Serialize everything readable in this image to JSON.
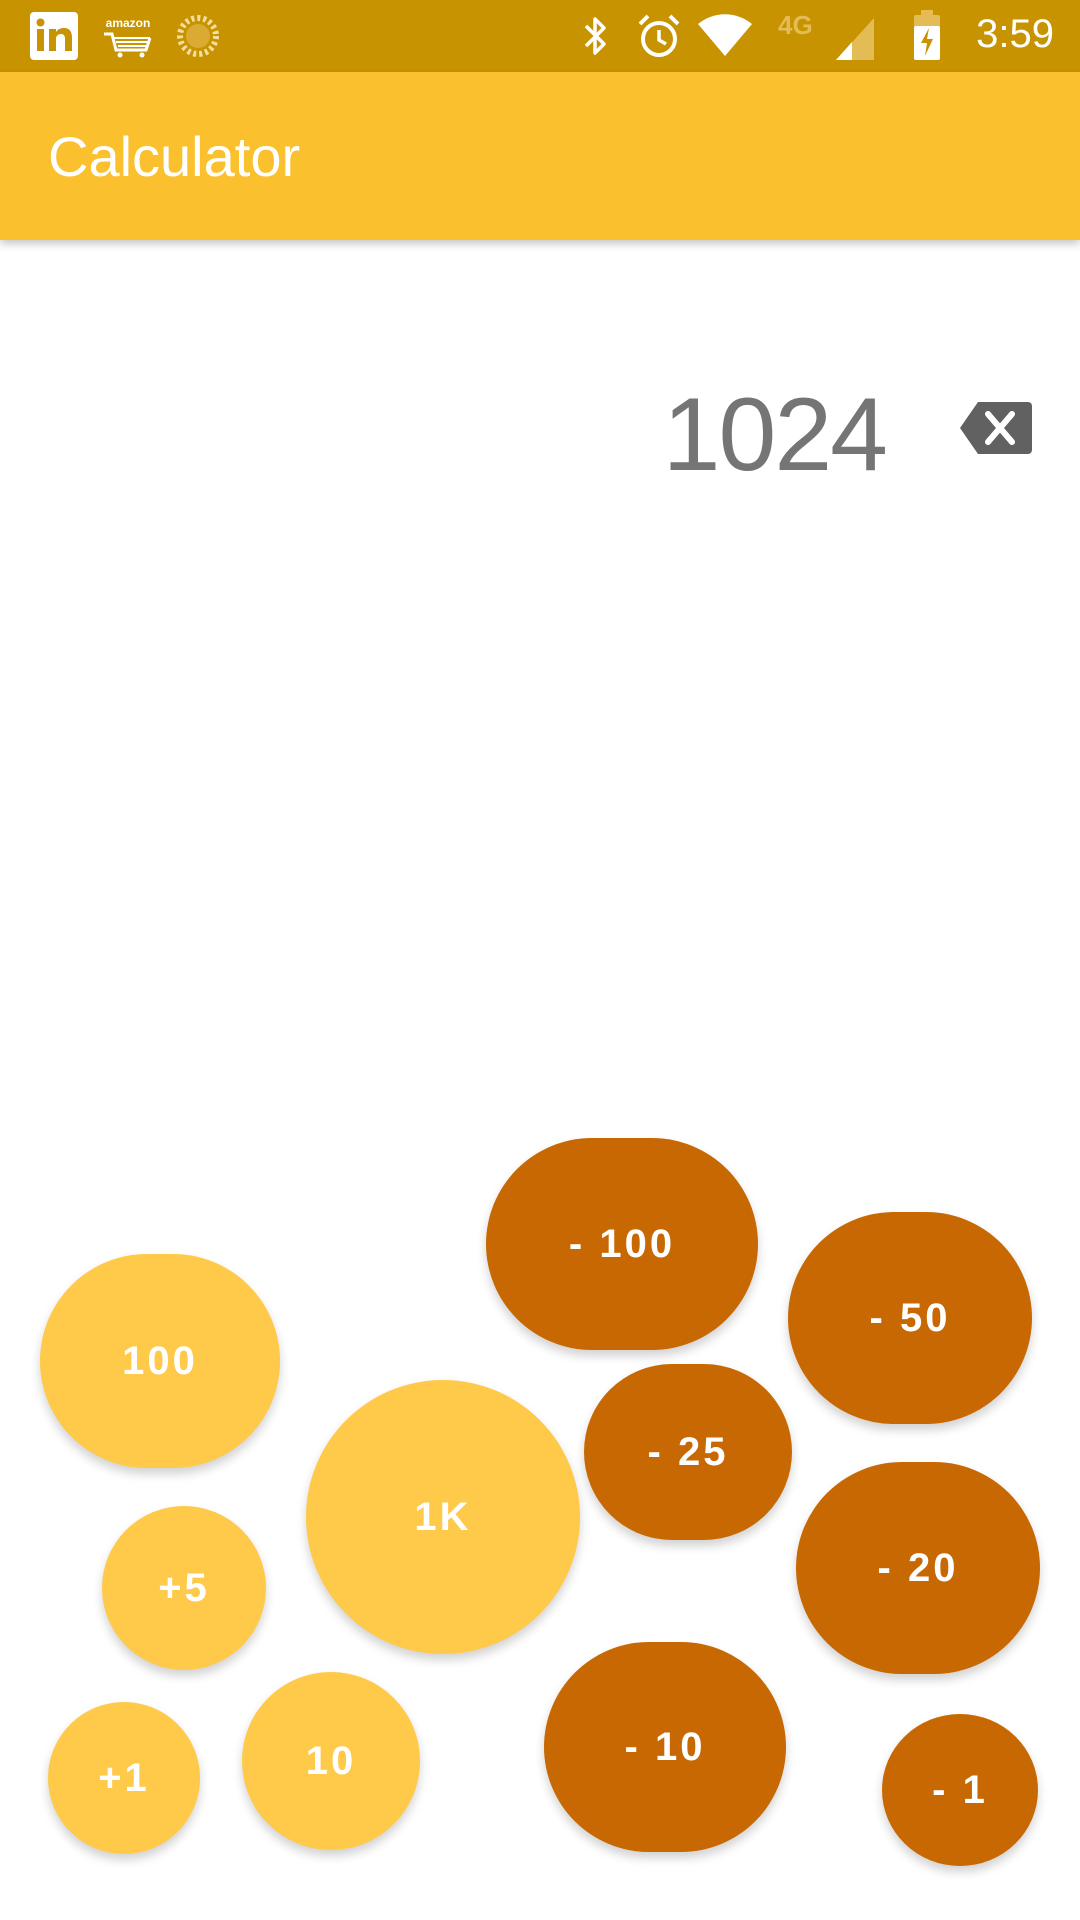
{
  "status_bar": {
    "time": "3:59",
    "left_icons": [
      "linkedin-icon",
      "amazon-icon",
      "loading-icon"
    ],
    "right_icons": [
      "bluetooth-icon",
      "alarm-icon",
      "wifi-icon",
      "signal-4g-icon",
      "battery-charging-icon"
    ],
    "network_label": "4G",
    "amazon_label": "amazon",
    "color": "#C89300"
  },
  "app_bar": {
    "title": "Calculator",
    "color": "#FBC02D"
  },
  "display": {
    "value": "1024",
    "backspace_icon": "backspace-icon"
  },
  "buttons": {
    "plus_color": "#FFC94A",
    "minus_color": "#C76803",
    "plus_1k": "1K",
    "plus_100": "100",
    "plus_10": "10",
    "plus_5": "+5",
    "plus_1": "+1",
    "minus_100": "- 100",
    "minus_50": "- 50",
    "minus_25": "- 25",
    "minus_20": "- 20",
    "minus_10": "- 10",
    "minus_1": "- 1"
  }
}
